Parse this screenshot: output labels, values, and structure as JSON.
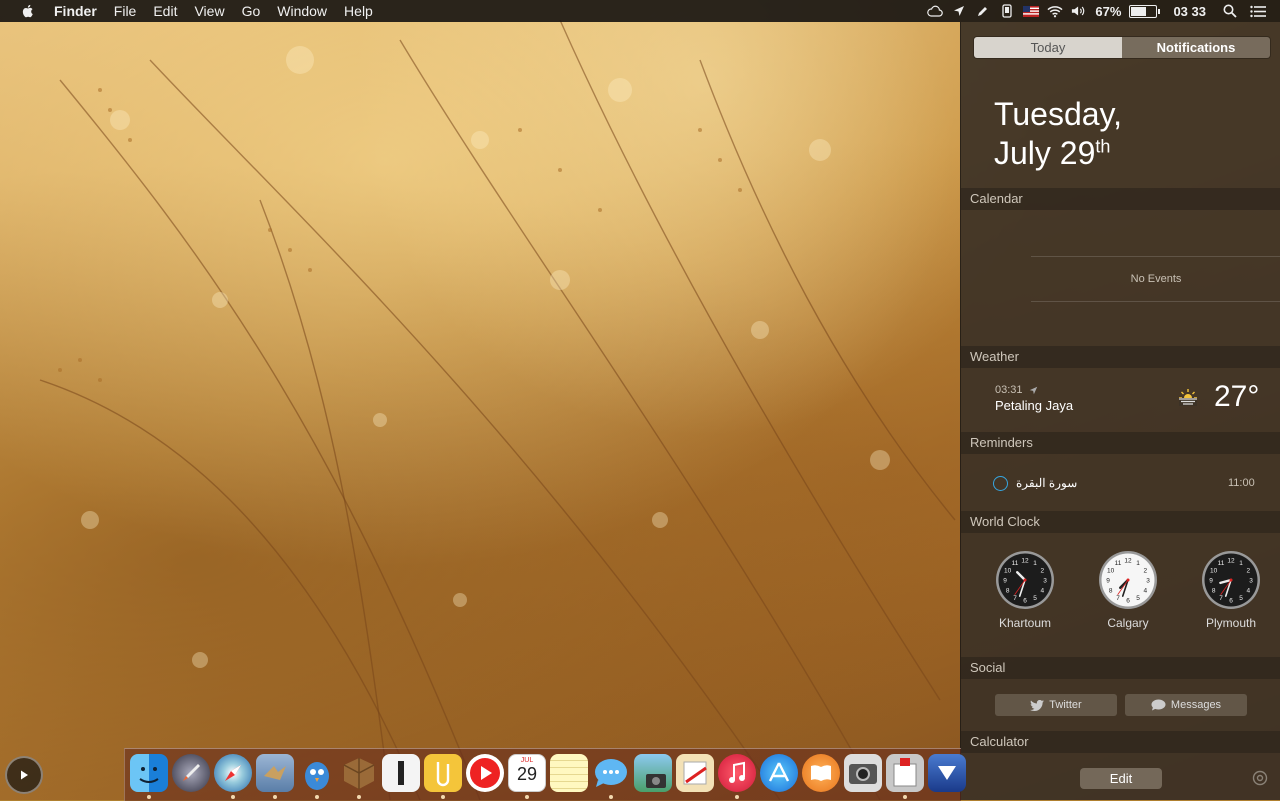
{
  "menubar": {
    "app": "Finder",
    "items": [
      "File",
      "Edit",
      "View",
      "Go",
      "Window",
      "Help"
    ],
    "status": {
      "battery_percent": "67%",
      "battery_level": 0.67,
      "clock": "03 33"
    }
  },
  "notification_center": {
    "tabs": {
      "today": "Today",
      "notifications": "Notifications"
    },
    "date_line1": "Tuesday,",
    "date_line2": "July 29",
    "date_suffix": "th",
    "calendar": {
      "header": "Calendar",
      "empty": "No Events"
    },
    "weather": {
      "header": "Weather",
      "time": "03:31",
      "city": "Petaling Jaya",
      "temp": "27°",
      "icon": "sunrise-icon"
    },
    "reminders": {
      "header": "Reminders",
      "items": [
        {
          "text": "سورة البقرة",
          "time": "11:00"
        }
      ]
    },
    "world_clock": {
      "header": "World Clock",
      "clocks": [
        {
          "city": "Khartoum",
          "face": "dark",
          "hour": 10.5,
          "minute": 33
        },
        {
          "city": "Calgary",
          "face": "light",
          "hour": 7.5,
          "minute": 33
        },
        {
          "city": "Plymouth",
          "face": "dark",
          "hour": 8.5,
          "minute": 33
        }
      ]
    },
    "social": {
      "header": "Social",
      "twitter": "Twitter",
      "messages": "Messages"
    },
    "calculator": {
      "header": "Calculator"
    },
    "edit_label": "Edit"
  },
  "dock": {
    "calendar_month": "JUL",
    "calendar_day": "29",
    "items": [
      "finder-icon",
      "launchpad-icon",
      "safari-icon",
      "mail-icon",
      "twitterrific-icon",
      "archive-utility-icon",
      "ia-writer-icon",
      "pages-icon",
      "youtube-icon",
      "calendar-icon",
      "notes-icon",
      "messages-icon",
      "photo-icon",
      "sketch-icon",
      "itunes-icon",
      "app-store-icon",
      "ibooks-icon",
      "photo-booth-icon",
      "preview-icon",
      "keynote-icon"
    ]
  },
  "colors": {
    "menubar": "#191612",
    "panel": "#3c3226",
    "reminder_circle": "#36a6e0",
    "accent_text": "#ffffff"
  }
}
